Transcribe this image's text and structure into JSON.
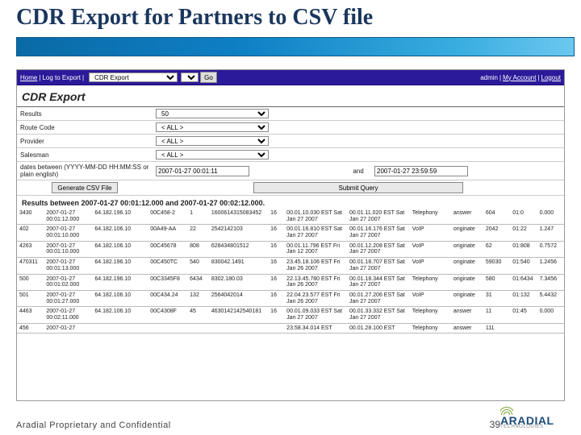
{
  "slide": {
    "title": "CDR Export for Partners to CSV file",
    "confidential": "Aradial Proprietary and Confidential",
    "page_number": "39",
    "logo_name": "ARADIAL",
    "logo_sub": "TECHNOLOGIES"
  },
  "topbar": {
    "home": "Home",
    "log": "Log to Export",
    "bread": "CDR Export",
    "go": "Go",
    "user": "admin",
    "account": "My Account",
    "logout": "Logout"
  },
  "page_heading": "CDR Export",
  "filters": {
    "results_lbl": "Results",
    "results_val": "50",
    "route_lbl": "Route Code",
    "route_val": "< ALL >",
    "provider_lbl": "Provider",
    "provider_val": "< ALL >",
    "salesman_lbl": "Salesman",
    "salesman_val": "< ALL >",
    "dates_lbl": "dates between (YYYY-MM-DD HH:MM:SS or plain english)",
    "date_from": "2007-01-27 00:01:11",
    "and_lbl": "and",
    "date_to": "2007-01-27 23:59:59",
    "csv_btn": "Generate CSV File",
    "submit_btn": "Submit Query"
  },
  "results_heading": "Results between 2007-01-27 00:01:12.000 and 2007-01-27 00:02:12.000.",
  "rows": [
    {
      "c0": "3430",
      "c1": "2007-01-27 00:01:12.000",
      "c2": "64.182.196.10",
      "c3": "00C458-2",
      "c4": "1",
      "c5": "1600614315083452",
      "c6": "16",
      "c7": "00.01.10.030 EST Sat Jan 27 2007",
      "c8": "00.01.11.020 EST Sat Jan 27 2007",
      "c9": "Telephony",
      "c10": "answer",
      "c11": "604",
      "c12": "01:0",
      "c13": "0.000"
    },
    {
      "c0": "402",
      "c1": "2007-01-27 00:01:10.000",
      "c2": "64.182.106.10",
      "c3": "00A49-AA",
      "c4": "22",
      "c5": "2542142103",
      "c6": "16",
      "c7": "00.01.16.810 EST Sat Jan 27 2007",
      "c8": "00.01.16.176 EST Sat Jan 27 2007",
      "c9": "VoIP",
      "c10": "originate",
      "c11": "2042",
      "c12": "01:22",
      "c13": "1.247"
    },
    {
      "c0": "4263",
      "c1": "2007-01-27 00:01:10.000",
      "c2": "64.182.106.10",
      "c3": "00C45678",
      "c4": "808",
      "c5": "628434801512",
      "c6": "16",
      "c7": "00.01.11.796 EST Fri Jan 12 2007",
      "c8": "00.01.12.208 EST Sat Jan 27 2007",
      "c9": "VoIP",
      "c10": "originate",
      "c11": "62",
      "c12": "01:808",
      "c13": "0.7572"
    },
    {
      "c0": "470311",
      "c1": "2007-01-27 00:01:13.000",
      "c2": "64.182.196.10",
      "c3": "00C450TC",
      "c4": "540",
      "c5": "830042.1491",
      "c6": "16",
      "c7": "23.45.18.106 EST Fri Jan 26 2007",
      "c8": "00.01.18.707 EST Sat Jan 27 2007",
      "c9": "VoIP",
      "c10": "originate",
      "c11": "59030",
      "c12": "01:540",
      "c13": "1.2456"
    },
    {
      "c0": "500",
      "c1": "2007-01-27 00:01:02.000",
      "c2": "64.182.196.10",
      "c3": "00C3345F8",
      "c4": "6434",
      "c5": "8302.180.03",
      "c6": "16",
      "c7": "22.13.45.780 EST Fri Jan 26 2007",
      "c8": "00.01.18.344 EST Sat Jan 27 2007",
      "c9": "Telephony",
      "c10": "originate",
      "c11": "580",
      "c12": "01:6434",
      "c13": "7.3456"
    },
    {
      "c0": "501",
      "c1": "2007-01-27 00:01:27.000",
      "c2": "64.182.106.10",
      "c3": "00C434.24",
      "c4": "132",
      "c5": "2564042014",
      "c6": "16",
      "c7": "22.04.23.577 EST Fri Jan 26 2007",
      "c8": "00.01.27.206 EST Sat Jan 27 2007",
      "c9": "VoIP",
      "c10": "originate",
      "c11": "31",
      "c12": "01:132",
      "c13": "5.4432"
    },
    {
      "c0": "4463",
      "c1": "2007-01-27 00:02:11.000",
      "c2": "64.182.106.10",
      "c3": "00C4308F",
      "c4": "45",
      "c5": "4630142142540181",
      "c6": "16",
      "c7": "00.01.09.033 EST Sat Jan 27 2007",
      "c8": "00.01.33.332 EST Sat Jan 27 2007",
      "c9": "Telephony",
      "c10": "answer",
      "c11": "11",
      "c12": "01:45",
      "c13": "0.000"
    },
    {
      "c0": "456",
      "c1": "2007-01-27",
      "c2": "",
      "c3": "",
      "c4": "",
      "c5": "",
      "c6": "",
      "c7": "23.58.34.014 EST",
      "c8": "00.01.28.100 EST",
      "c9": "Telephony",
      "c10": "answer",
      "c11": "111",
      "c12": "",
      "c13": ""
    }
  ]
}
